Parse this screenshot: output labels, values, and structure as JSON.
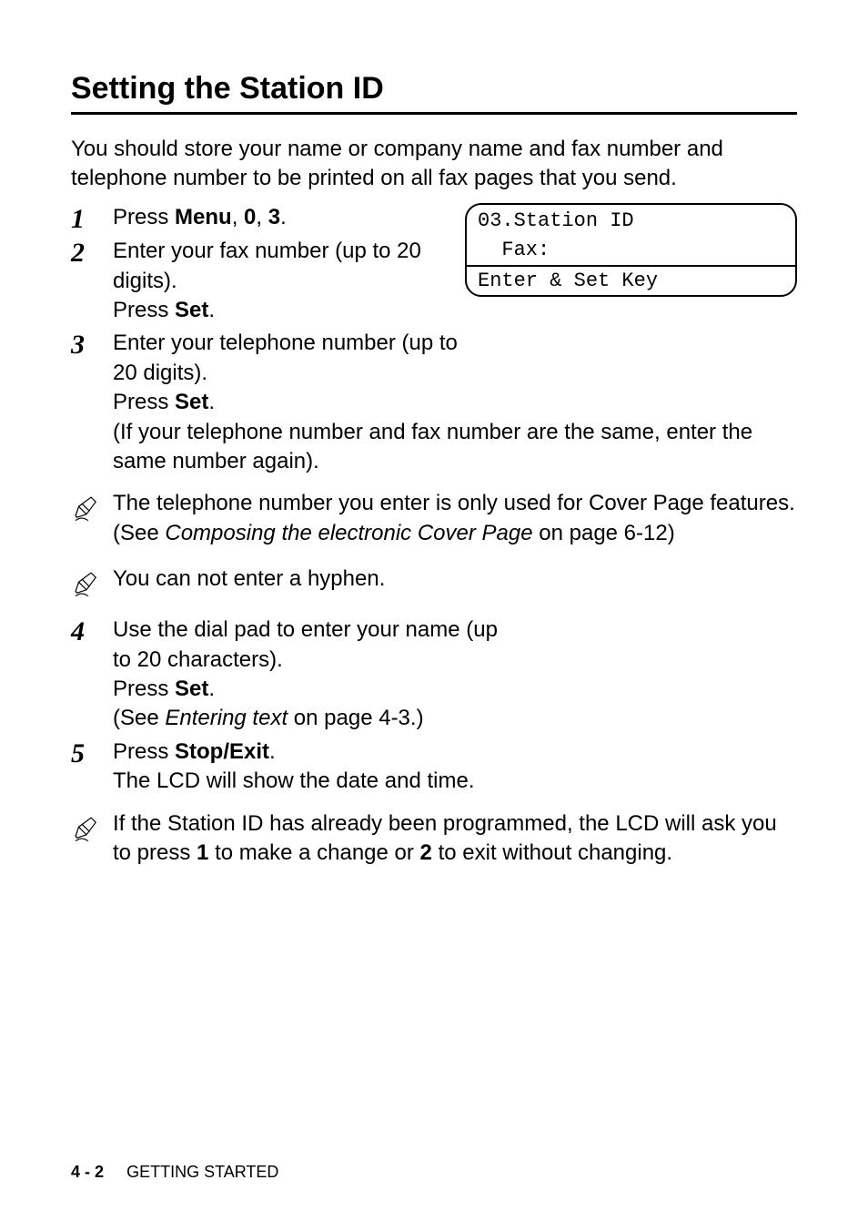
{
  "title": "Setting the Station ID",
  "intro": "You should store your name or company name and fax number and telephone number to be printed on all fax pages that you send.",
  "lcd": {
    "line1": "03.Station ID",
    "line2": "",
    "line3": "  Fax:",
    "line4": "Enter & Set Key"
  },
  "steps": {
    "s1": {
      "num": "1",
      "t1": "Press ",
      "b1": "Menu",
      "t2": ", ",
      "b2": "0",
      "t3": ", ",
      "b3": "3",
      "t4": "."
    },
    "s2": {
      "num": "2",
      "l1a": "Enter your fax number (up to 20 digits).",
      "l2a": "Press ",
      "l2b": "Set",
      "l2c": "."
    },
    "s3": {
      "num": "3",
      "l1": "Enter your telephone number (up to 20 digits).",
      "l2a": "Press ",
      "l2b": "Set",
      "l2c": ".",
      "l3": "(If your telephone number and fax number are the same, enter the same number again)."
    },
    "s4": {
      "num": "4",
      "l1": "Use the dial pad to enter your name (up to 20 characters).",
      "l2a": "Press ",
      "l2b": "Set",
      "l2c": ".",
      "l3a": "(See ",
      "l3b": "Entering text",
      "l3c": " on page 4-3.)"
    },
    "s5": {
      "num": "5",
      "l1a": "Press ",
      "l1b": "Stop/Exit",
      "l1c": ".",
      "l2": "The LCD will show the date and time."
    }
  },
  "notes": {
    "n1": {
      "t1": "The telephone number you enter is only used for Cover Page features.(See ",
      "t2": "Composing the electronic Cover Page",
      "t3": " on page 6-12)"
    },
    "n2": {
      "t1": "You can not enter a hyphen."
    },
    "n3": {
      "t1": "If the Station ID has already been programmed, the LCD will ask you to press ",
      "b1": "1",
      "t2": " to make a change or ",
      "b2": "2",
      "t3": " to exit without changing."
    }
  },
  "footer": {
    "page": "4 - 2",
    "section": "GETTING STARTED"
  }
}
